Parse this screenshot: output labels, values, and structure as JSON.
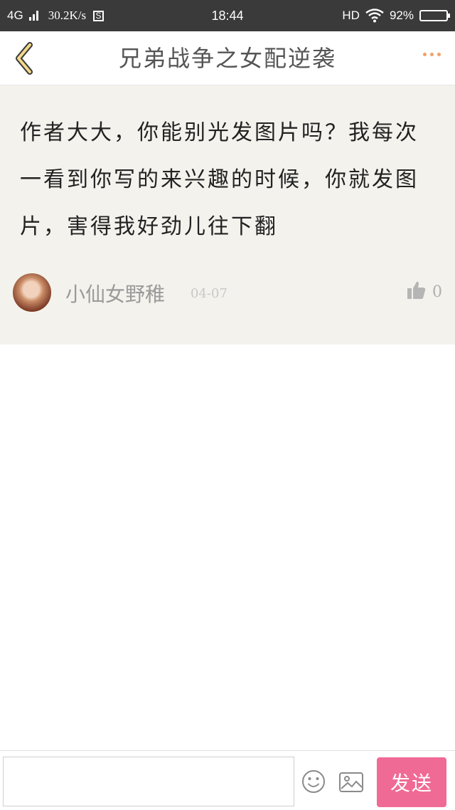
{
  "status_bar": {
    "network": "4G",
    "speed": "30.2K/s",
    "s_badge": "S",
    "time": "18:44",
    "hd": "HD",
    "battery": "92%",
    "battery_level": 0.92
  },
  "header": {
    "title": "兄弟战争之女配逆袭",
    "back_icon": "chevron-left-icon",
    "more_icon": "more-dots-icon",
    "accent_color": "#f0a068"
  },
  "comment": {
    "text": "作者大大，你能别光发图片吗？我每次一看到你写的来兴趣的时候，你就发图片，害得我好劲儿往下翻",
    "author": "小仙女野稚",
    "date": "04-07",
    "likes": "0",
    "like_icon": "thumbs-up-icon"
  },
  "bottom_bar": {
    "input_value": "",
    "emoji_icon": "smiley-icon",
    "image_icon": "image-icon",
    "send_label": "发送",
    "send_color": "#f06a96"
  }
}
